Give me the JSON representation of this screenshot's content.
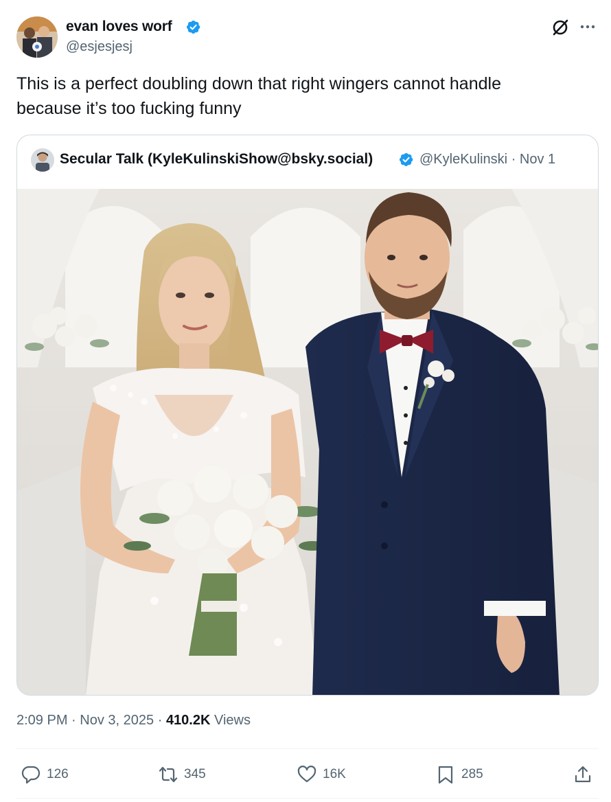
{
  "author": {
    "name": "evan loves worf",
    "handle": "@esjesjesj"
  },
  "tweet": {
    "text_line1": "This is a perfect doubling down that right wingers cannot handle",
    "text_line2": "because it’s too fucking funny"
  },
  "quote": {
    "name": "Secular Talk (KyleKulinskiShow@bsky.social)",
    "handle": "@KyleKulinski",
    "separator": "·",
    "date": "Nov 1"
  },
  "meta": {
    "time": "2:09 PM",
    "sep1": "·",
    "date": "Nov 3, 2025",
    "sep2": "·",
    "views_count": "410.2K",
    "views_label": "Views"
  },
  "actions": {
    "replies": "126",
    "reposts": "345",
    "likes": "16K",
    "bookmarks": "285"
  },
  "icons": [
    "verified-badge-icon",
    "grok-icon",
    "more-icon",
    "reply-icon",
    "repost-icon",
    "like-icon",
    "bookmark-icon",
    "share-icon"
  ],
  "colors": {
    "accent": "#1d9bf0",
    "secondary_text": "#536471",
    "primary_text": "#0f1419",
    "border": "#cfd9de"
  }
}
